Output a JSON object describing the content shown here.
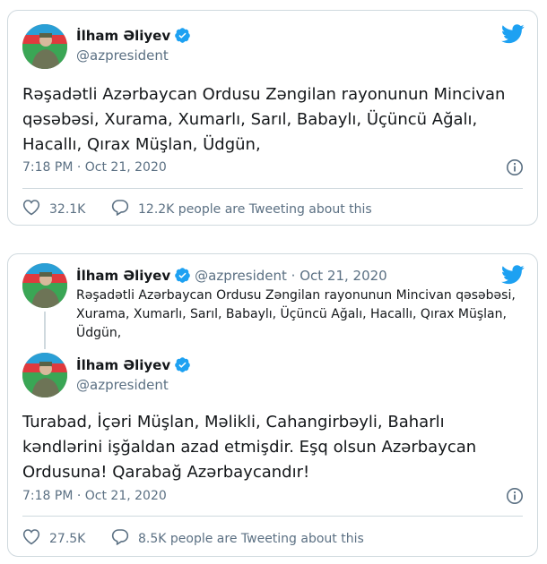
{
  "tweet1": {
    "author_name": "İlham Əliyev",
    "author_handle": "@azpresident",
    "text": "Rəşadətli Azərbaycan Ordusu Zəngilan rayonunun Mincivan\nqəsəbəsi, Xurama, Xumarlı, Sarıl, Babaylı, Üçüncü Ağalı,\nHacallı, Qırax Müşlan, Üdgün,",
    "timestamp": "7:18 PM · Oct 21, 2020",
    "likes": "32.1K",
    "people_tweeting": "12.2K people are Tweeting about this"
  },
  "tweet2": {
    "quoted": {
      "author_name": "İlham Əliyev",
      "handle_date": "@azpresident · Oct 21, 2020",
      "text": "Rəşadətli Azərbaycan Ordusu Zəngilan rayonunun Mincivan qəsəbəsi,\nXurama, Xumarlı, Sarıl, Babaylı, Üçüncü Ağalı, Hacallı, Qırax Müşlan,\nÜdgün,"
    },
    "author_name": "İlham Əliyev",
    "author_handle": "@azpresident",
    "text": "Turabad, İçəri Müşlan, Məlikli, Cahangirbəyli, Baharlı\nkəndlərini işğaldan azad etmişdir. Eşq olsun Azərbaycan\nOrdusuna! Qarabağ Azərbaycandır!",
    "timestamp": "7:18 PM · Oct 21, 2020",
    "likes": "27.5K",
    "people_tweeting": "8.5K people are Tweeting about this"
  },
  "colors": {
    "twitter_blue": "#1da1f2",
    "text_primary": "#14171a",
    "text_secondary": "#5b7083",
    "border": "#cfd9de"
  },
  "icons": [
    "verified-badge-icon",
    "twitter-bird-icon",
    "info-icon",
    "heart-icon",
    "speech-bubble-icon"
  ]
}
